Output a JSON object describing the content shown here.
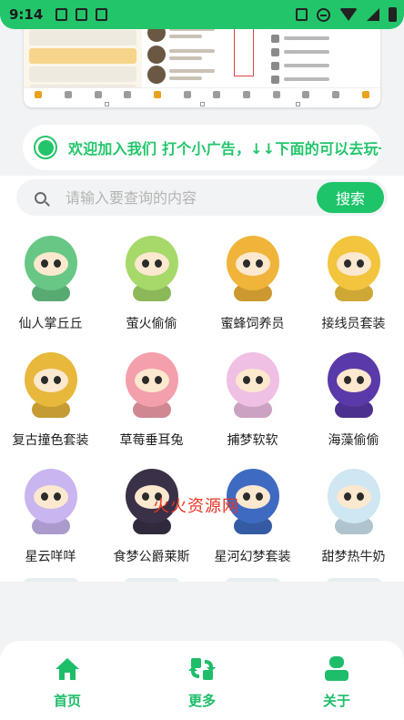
{
  "status_bar": {
    "time": "9:14"
  },
  "notice": {
    "text": "欢迎加入我们  打个小广告，↓↓下面的可以去玩一"
  },
  "search": {
    "placeholder": "请输入要查询的内容",
    "button_label": "搜索"
  },
  "items": [
    {
      "name": "仙人掌丘丘",
      "icon": "cactus-figure",
      "color": "#69c786"
    },
    {
      "name": "萤火偷偷",
      "icon": "firefly-figure",
      "color": "#a6d86a"
    },
    {
      "name": "蜜蜂饲养员",
      "icon": "bee-keeper-figure",
      "color": "#f0b43a"
    },
    {
      "name": "接线员套装",
      "icon": "operator-figure",
      "color": "#f3c53e"
    },
    {
      "name": "复古撞色套装",
      "icon": "retro-figure",
      "color": "#e8b83c"
    },
    {
      "name": "草莓垂耳兔",
      "icon": "strawberry-bunny-figure",
      "color": "#f3a0ac"
    },
    {
      "name": "捕梦软软",
      "icon": "dreamcatcher-figure",
      "color": "#f0bfe4"
    },
    {
      "name": "海藻偷偷",
      "icon": "seaweed-figure",
      "color": "#5a3aa8"
    },
    {
      "name": "星云咩咩",
      "icon": "nebula-sheep-figure",
      "color": "#c9b6f0"
    },
    {
      "name": "食梦公爵莱斯",
      "icon": "dream-duke-figure",
      "color": "#3a3148"
    },
    {
      "name": "星河幻梦套装",
      "icon": "galaxy-dream-figure",
      "color": "#3e6bc1"
    },
    {
      "name": "甜梦热牛奶",
      "icon": "milk-figure",
      "color": "#cfe6f3"
    }
  ],
  "watermark": {
    "text": "火火资源网"
  },
  "tabbar": [
    {
      "label": "首页",
      "icon": "home-icon"
    },
    {
      "label": "更多",
      "icon": "refresh-icon"
    },
    {
      "label": "关于",
      "icon": "user-icon"
    }
  ],
  "colors": {
    "accent": "#1dc46a",
    "status_bar": "#23c56b"
  }
}
